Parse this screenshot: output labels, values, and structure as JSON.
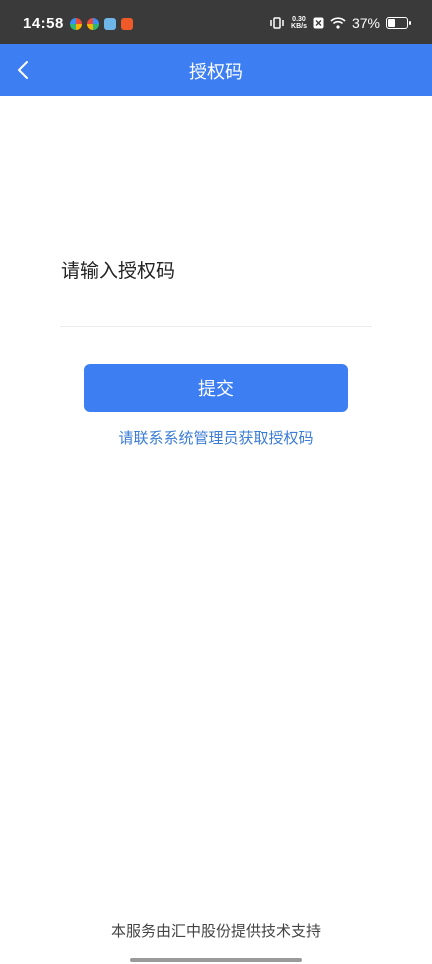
{
  "status_bar": {
    "time": "14:58",
    "net_speed_value": "0.30",
    "net_speed_unit": "KB/s",
    "battery_text": "37%"
  },
  "header": {
    "title": "授权码"
  },
  "form": {
    "label": "请输入授权码",
    "input_value": "",
    "input_placeholder": "",
    "submit_label": "提交",
    "contact_hint": "请联系系统管理员获取授权码"
  },
  "footer": {
    "text": "本服务由汇中股份提供技术支持"
  },
  "colors": {
    "header_bg": "#3d7ff2",
    "button_bg": "#3d7ff2",
    "link": "#3b7cd6",
    "status_bar_bg": "#3a3a3a"
  }
}
